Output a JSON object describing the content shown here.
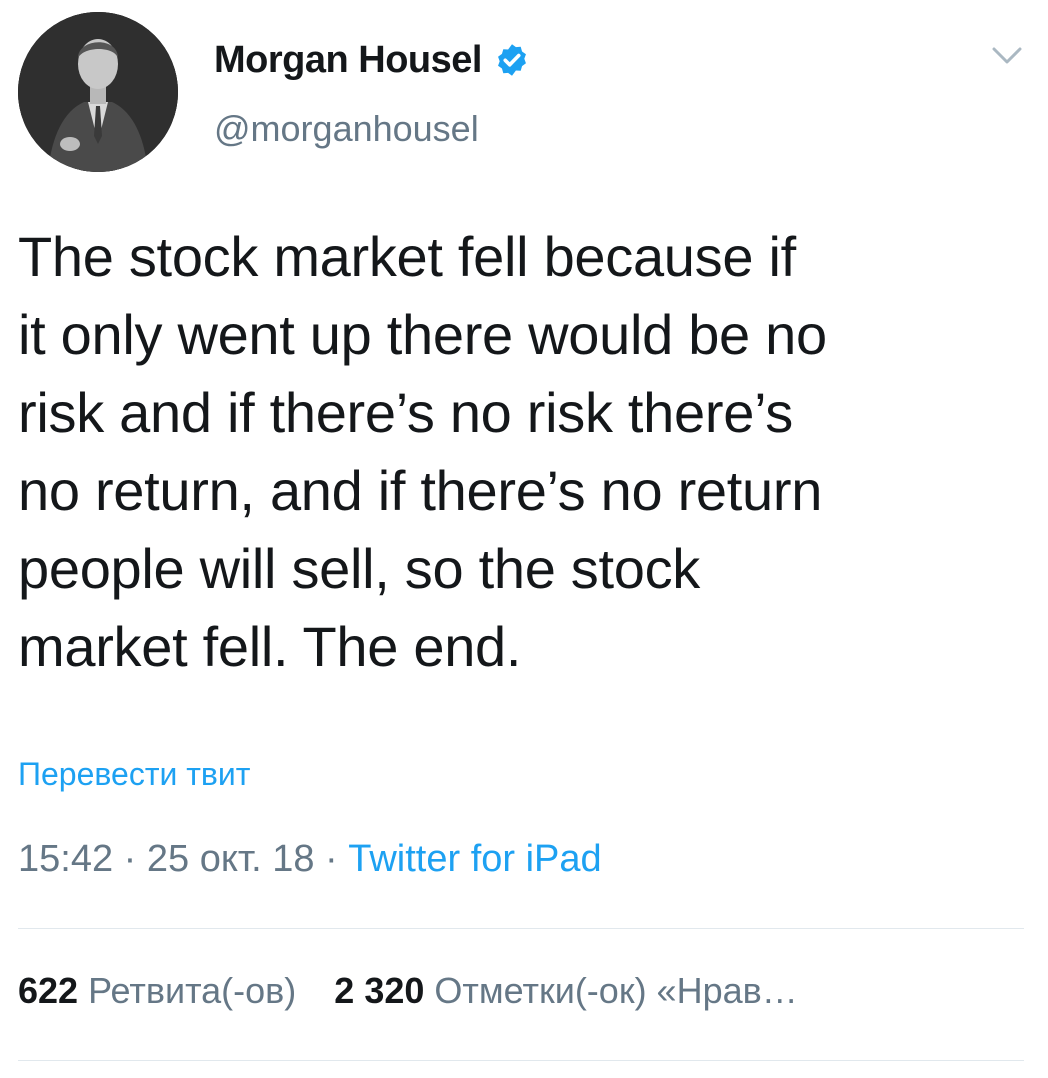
{
  "tweet": {
    "author": {
      "name": "Morgan Housel",
      "handle": "@morganhousel",
      "verified": true
    },
    "text": "The stock market fell because if\nit only went up there would be no\nrisk and if there’s no risk there’s\nno return, and if there’s no return\npeople will sell, so the stock\nmarket fell. The end.",
    "translate_label": "Перевести твит",
    "time": "15:42",
    "date": "25 окт. 18",
    "separator": " · ",
    "source": "Twitter for iPad",
    "stats": {
      "retweets_count": "622",
      "retweets_label": "Ретвита(-ов)",
      "likes_count": "2 320",
      "likes_label": "Отметки(-ок) «Нрав…"
    }
  },
  "icons": {
    "verified": "verified-badge-icon",
    "menu": "chevron-down-icon"
  },
  "colors": {
    "accent": "#1da1f2",
    "text": "#14171a",
    "secondary": "#657786",
    "divider": "#e1e8ed"
  }
}
